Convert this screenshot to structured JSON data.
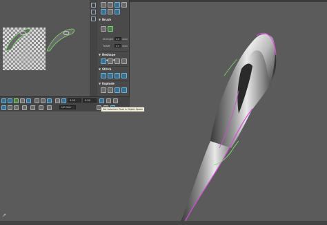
{
  "toolkit": {
    "brush": {
      "header": "Brush",
      "strength_label": "Strength",
      "strength_value": "0.5",
      "falloff_label": "Falloff",
      "falloff_value": "0.5"
    },
    "reshape_elements": {
      "header": "Reshape Elements"
    },
    "stitch": {
      "header": "Stitch"
    },
    "explode": {
      "header": "Explode"
    }
  },
  "uv_toolbar": {
    "field_1_value": "0.00",
    "field_2_value": "0.00",
    "field_3_value": "UV Grid"
  },
  "tooltip": {
    "text": "Set Selection Pivot in Object Space"
  },
  "icons": {
    "axis": "axis-gizmo-icon",
    "toolkit_expand": "triangle-right-icon"
  },
  "colors": {
    "viewport_bg": "#5b5b5b",
    "selection_highlight": "#d84ad8",
    "uv_border": "#7ce06a",
    "button_blue": "#3c6f8d"
  }
}
